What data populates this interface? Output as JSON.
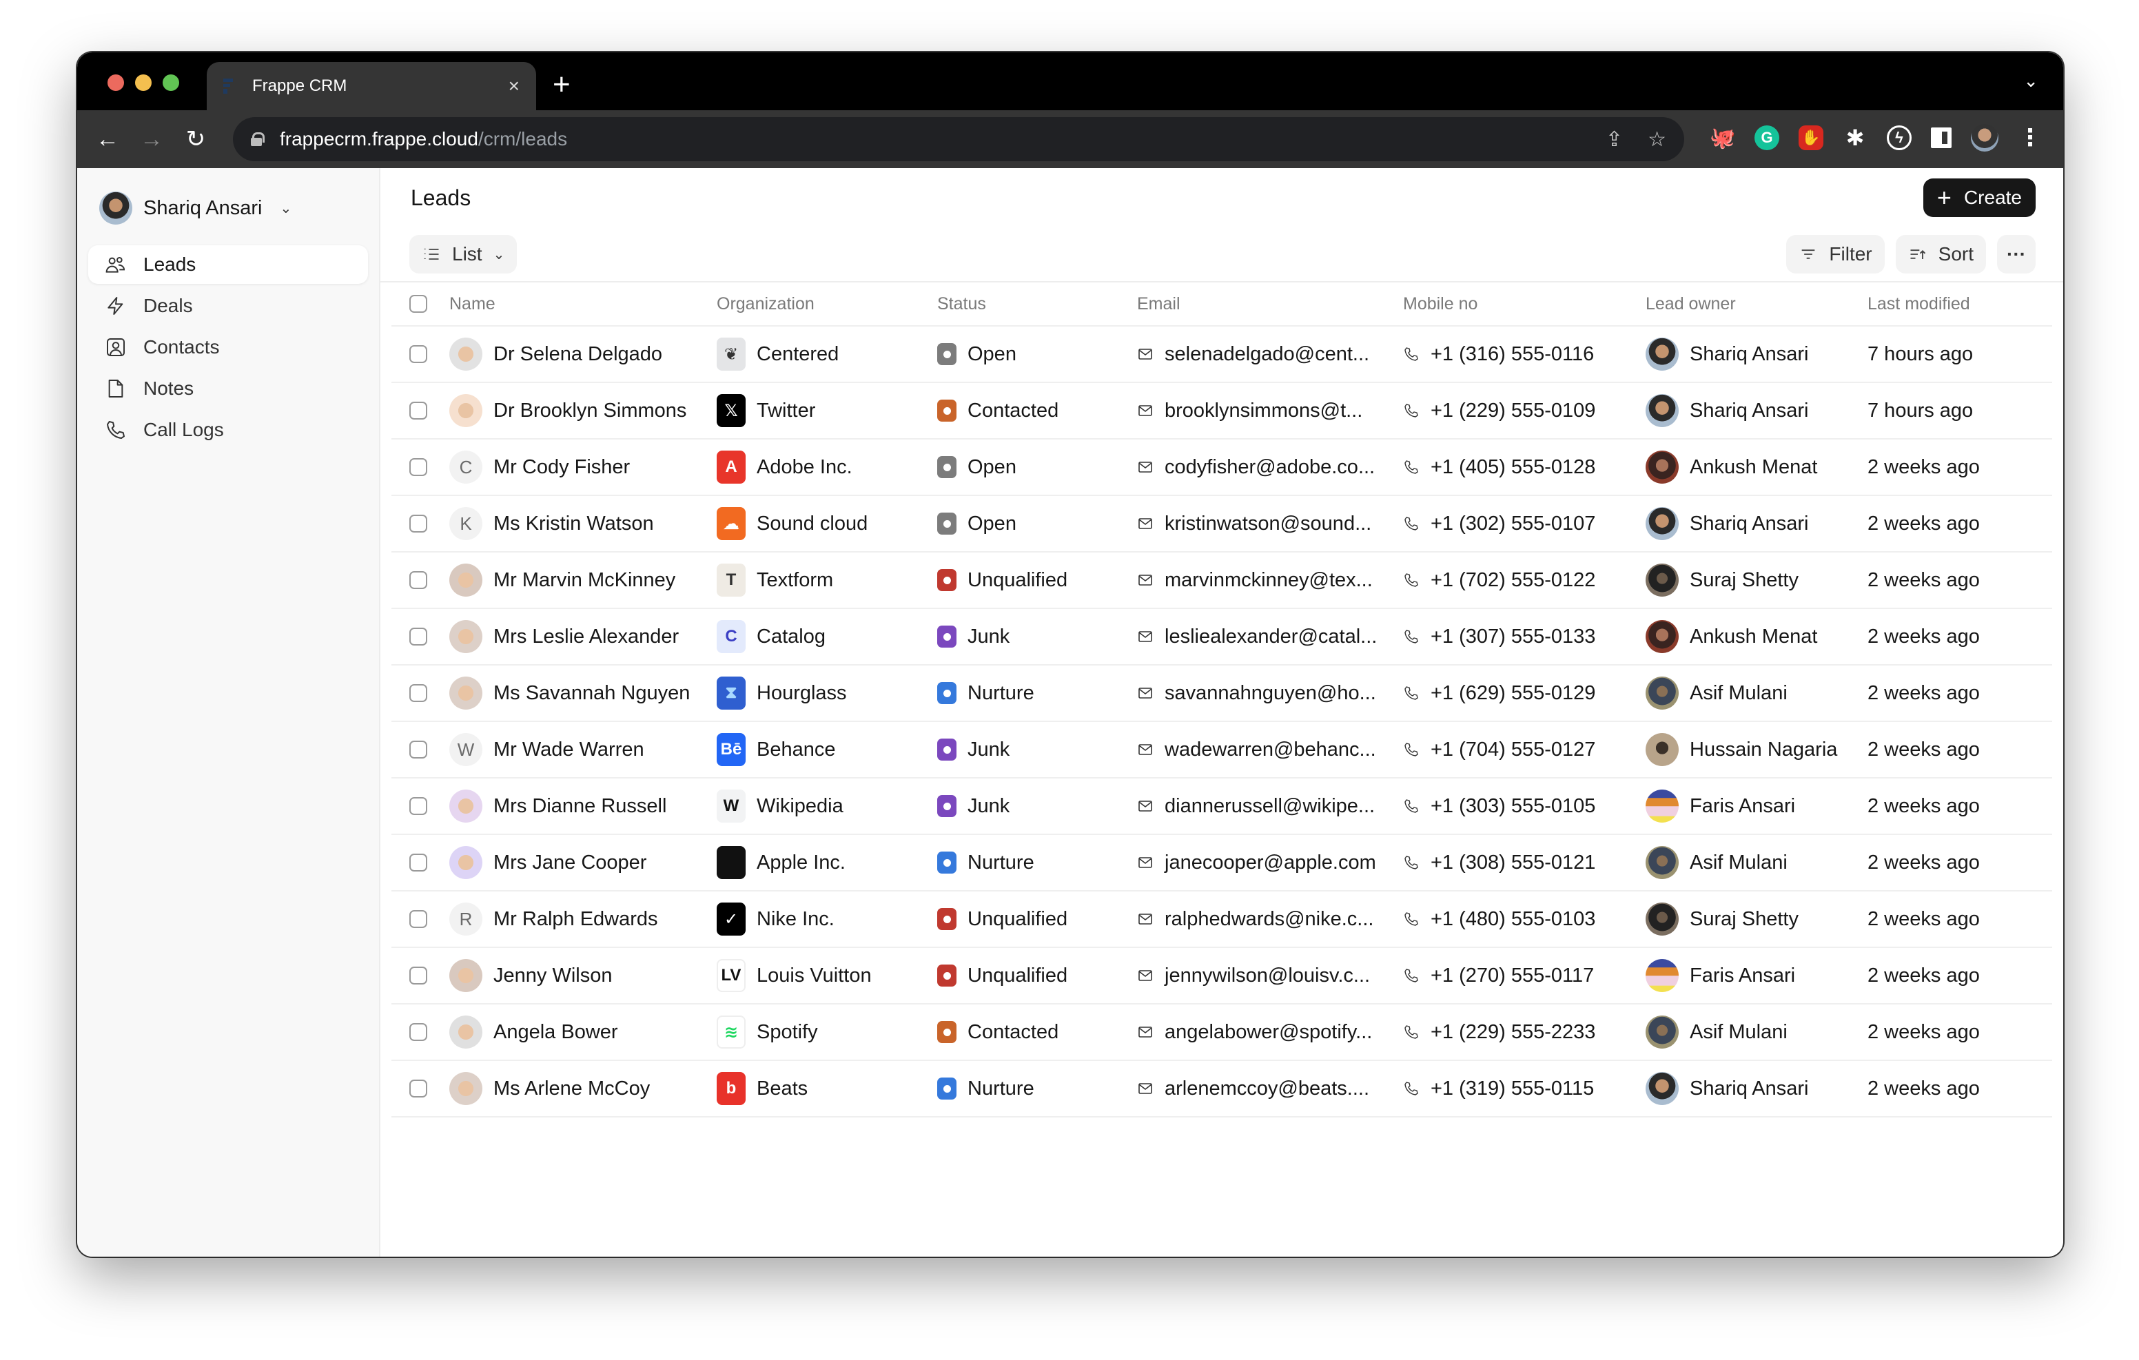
{
  "browser": {
    "tab_title": "Frappe CRM",
    "tab_close": "×",
    "new_tab": "+",
    "url_host": "frappecrm.frappe.cloud",
    "url_path": "/crm/leads",
    "traffic_colors": {
      "close": "#ec6a5e",
      "minimize": "#f4bf4f",
      "maximize": "#61c554"
    },
    "extensions": [
      "octocat-extension-icon",
      "grammarly-icon",
      "adblock-icon",
      "puzzle-extensions-icon",
      "leaf-bolt-extension-icon",
      "sidepanel-icon",
      "profile-avatar",
      "kebab-menu-icon"
    ]
  },
  "sidebar": {
    "user_name": "Shariq Ansari",
    "items": [
      {
        "label": "Leads",
        "icon": "users-icon",
        "active": true
      },
      {
        "label": "Deals",
        "icon": "lightning-icon",
        "active": false
      },
      {
        "label": "Contacts",
        "icon": "contact-card-icon",
        "active": false
      },
      {
        "label": "Notes",
        "icon": "note-icon",
        "active": false
      },
      {
        "label": "Call Logs",
        "icon": "phone-icon",
        "active": false
      }
    ]
  },
  "header": {
    "title": "Leads",
    "create_label": "Create",
    "view_label": "List",
    "filter_label": "Filter",
    "sort_label": "Sort",
    "more_label": "···"
  },
  "table": {
    "columns": [
      "Name",
      "Organization",
      "Status",
      "Email",
      "Mobile no",
      "Lead owner",
      "Last modified"
    ],
    "status_colors": {
      "Open": "#7c7c7c",
      "Contacted": "#c9642a",
      "Unqualified": "#c0392f",
      "Junk": "#7b48be",
      "Nurture": "#3579dc"
    },
    "rows": [
      {
        "name": "Dr Selena Delgado",
        "avatar": "memoji",
        "avatar_bg": "#e2e2e2",
        "org": "Centered",
        "org_logo": "❦",
        "org_bg": "#e4e5e7",
        "org_fg": "#333333",
        "status": "Open",
        "email": "selenadelgado@cent...",
        "mobile": "+1 (316) 555-0116",
        "owner": "Shariq Ansari",
        "modified": "7 hours ago"
      },
      {
        "name": "Dr Brooklyn Simmons",
        "avatar": "memoji",
        "avatar_bg": "#f6e0cf",
        "org": "Twitter",
        "org_logo": "𝕏",
        "org_bg": "#000000",
        "org_fg": "#ffffff",
        "status": "Contacted",
        "email": "brooklynsimmons@t...",
        "mobile": "+1 (229) 555-0109",
        "owner": "Shariq Ansari",
        "modified": "7 hours ago"
      },
      {
        "name": "Mr Cody Fisher",
        "avatar": "C",
        "avatar_bg": "#f2f2f2",
        "org": "Adobe Inc.",
        "org_logo": "A",
        "org_bg": "#e8352a",
        "org_fg": "#ffffff",
        "status": "Open",
        "email": "codyfisher@adobe.co...",
        "mobile": "+1 (405) 555-0128",
        "owner": "Ankush Menat",
        "modified": "2 weeks ago"
      },
      {
        "name": "Ms Kristin Watson",
        "avatar": "K",
        "avatar_bg": "#f2f2f2",
        "org": "Sound cloud",
        "org_logo": "☁",
        "org_bg": "#f26a21",
        "org_fg": "#ffffff",
        "status": "Open",
        "email": "kristinwatson@sound...",
        "mobile": "+1 (302) 555-0107",
        "owner": "Shariq Ansari",
        "modified": "2 weeks ago"
      },
      {
        "name": "Mr Marvin McKinney",
        "avatar": "memoji",
        "avatar_bg": "#d9c9bf",
        "org": "Textform",
        "org_logo": "T",
        "org_bg": "#efebe4",
        "org_fg": "#333333",
        "status": "Unqualified",
        "email": "marvinmckinney@tex...",
        "mobile": "+1 (702) 555-0122",
        "owner": "Suraj Shetty",
        "modified": "2 weeks ago"
      },
      {
        "name": "Mrs Leslie Alexander",
        "avatar": "memoji",
        "avatar_bg": "#ddd0c8",
        "org": "Catalog",
        "org_logo": "C",
        "org_bg": "#e3eafc",
        "org_fg": "#3b3fc4",
        "status": "Junk",
        "email": "lesliealexander@catal...",
        "mobile": "+1 (307) 555-0133",
        "owner": "Ankush Menat",
        "modified": "2 weeks ago"
      },
      {
        "name": "Ms Savannah Nguyen",
        "avatar": "memoji",
        "avatar_bg": "#ddd0c8",
        "org": "Hourglass",
        "org_logo": "⧗",
        "org_bg": "#2f5fd0",
        "org_fg": "#a8d8ff",
        "status": "Nurture",
        "email": "savannahnguyen@ho...",
        "mobile": "+1 (629) 555-0129",
        "owner": "Asif Mulani",
        "modified": "2 weeks ago"
      },
      {
        "name": "Mr Wade Warren",
        "avatar": "W",
        "avatar_bg": "#f2f2f2",
        "org": "Behance",
        "org_logo": "Bē",
        "org_bg": "#2266f5",
        "org_fg": "#ffffff",
        "status": "Junk",
        "email": "wadewarren@behanc...",
        "mobile": "+1 (704) 555-0127",
        "owner": "Hussain Nagaria",
        "modified": "2 weeks ago"
      },
      {
        "name": "Mrs Dianne Russell",
        "avatar": "memoji",
        "avatar_bg": "#e6d6f0",
        "org": "Wikipedia",
        "org_logo": "W",
        "org_bg": "#f2f3f4",
        "org_fg": "#111111",
        "status": "Junk",
        "email": "diannerussell@wikipe...",
        "mobile": "+1 (303) 555-0105",
        "owner": "Faris Ansari",
        "modified": "2 weeks ago"
      },
      {
        "name": "Mrs Jane Cooper",
        "avatar": "memoji",
        "avatar_bg": "#ddd4f6",
        "org": "Apple Inc.",
        "org_logo": "",
        "org_bg": "#111111",
        "org_fg": "#ffffff",
        "status": "Nurture",
        "email": "janecooper@apple.com",
        "mobile": "+1 (308) 555-0121",
        "owner": "Asif Mulani",
        "modified": "2 weeks ago"
      },
      {
        "name": "Mr Ralph Edwards",
        "avatar": "R",
        "avatar_bg": "#f2f2f2",
        "org": "Nike Inc.",
        "org_logo": "✓",
        "org_bg": "#000000",
        "org_fg": "#ffffff",
        "status": "Unqualified",
        "email": "ralphedwards@nike.c...",
        "mobile": "+1 (480) 555-0103",
        "owner": "Suraj Shetty",
        "modified": "2 weeks ago"
      },
      {
        "name": "Jenny Wilson",
        "avatar": "memoji",
        "avatar_bg": "#d9c9bf",
        "org": "Louis Vuitton",
        "org_logo": "LV",
        "org_bg": "#ffffff",
        "org_fg": "#111111",
        "status": "Unqualified",
        "email": "jennywilson@louisv.c...",
        "mobile": "+1 (270) 555-0117",
        "owner": "Faris Ansari",
        "modified": "2 weeks ago"
      },
      {
        "name": "Angela Bower",
        "avatar": "memoji",
        "avatar_bg": "#e0e0e0",
        "org": "Spotify",
        "org_logo": "≋",
        "org_bg": "#ffffff",
        "org_fg": "#1ed760",
        "status": "Contacted",
        "email": "angelabower@spotify...",
        "mobile": "+1 (229) 555-2233",
        "owner": "Asif Mulani",
        "modified": "2 weeks ago"
      },
      {
        "name": "Ms Arlene McCoy",
        "avatar": "memoji",
        "avatar_bg": "#ddd0c8",
        "org": "Beats",
        "org_logo": "b",
        "org_bg": "#e8322a",
        "org_fg": "#ffffff",
        "status": "Nurture",
        "email": "arlenemccoy@beats....",
        "mobile": "+1 (319) 555-0115",
        "owner": "Shariq Ansari",
        "modified": "2 weeks ago"
      }
    ]
  }
}
